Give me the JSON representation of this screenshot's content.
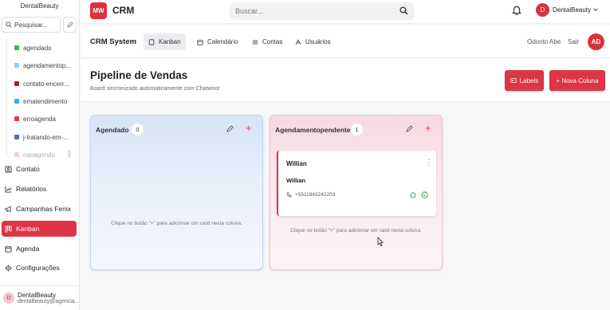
{
  "sidebar": {
    "brand": "DentalBeauty",
    "search_placeholder": "Pesquisar...",
    "labels": [
      {
        "name": "agendado",
        "color": "#4caf50"
      },
      {
        "name": "agendamentop...",
        "color": "#90caf9"
      },
      {
        "name": "contato-encerr...",
        "color": "#b71c1c"
      },
      {
        "name": "ematendimento",
        "color": "#42a5f5"
      },
      {
        "name": "erroagenda",
        "color": "#e53950"
      },
      {
        "name": "j-tratando-em-...",
        "color": "#5c6bc0"
      },
      {
        "name": "naoagendo",
        "color": "#f48fb1"
      }
    ],
    "nav": [
      {
        "label": "Contato",
        "icon": "contact-icon"
      },
      {
        "label": "Relatórios",
        "icon": "chart-icon"
      },
      {
        "label": "Campanhas Fenix",
        "icon": "megaphone-icon"
      },
      {
        "label": "Kanban",
        "icon": "kanban-icon"
      },
      {
        "label": "Agenda",
        "icon": "calendar-icon"
      },
      {
        "label": "Configurações",
        "icon": "gear-icon"
      }
    ],
    "active_nav": "Kanban",
    "user": {
      "initial": "D",
      "name": "DentalBeauty",
      "email": "dentalbeauty@agencia..."
    }
  },
  "header": {
    "logo_initials": "MW",
    "app_name": "CRM",
    "search_placeholder": "Buscar...",
    "user_initial": "D",
    "user_name": "DentalBeauty"
  },
  "subnav": {
    "title": "CRM System",
    "tabs": [
      {
        "label": "Kanban",
        "icon": "kanban-icon"
      },
      {
        "label": "Calendário",
        "icon": "calendar-icon"
      },
      {
        "label": "Contas",
        "icon": "list-icon"
      },
      {
        "label": "Usuários",
        "icon": "users-icon"
      }
    ],
    "active_tab": "Kanban",
    "user_name": "Odonto Abe",
    "logout": "Sair",
    "avatar": "AD"
  },
  "page": {
    "title": "Pipeline de Vendas",
    "subtitle": "Board sincronizado automaticamente com Chatwoot",
    "labels_button": "Labels",
    "new_column_button": "+ Nova Coluna"
  },
  "board": {
    "columns": [
      {
        "title": "Agendado",
        "count": "0",
        "empty_text": "Clique no botão \"+\" para adicionar um card nesta coluna."
      },
      {
        "title": "Agendamentopendente",
        "count": "1",
        "empty_text": "Clique no botão \"+\" para adicionar um card nesta coluna.",
        "cards": [
          {
            "title": "Willian",
            "name": "Willian",
            "phone": "+5511943242203"
          }
        ]
      }
    ]
  },
  "colors": {
    "accent": "#dc3545",
    "column_a": "#dbe6f8",
    "column_b": "#f8dce4"
  }
}
